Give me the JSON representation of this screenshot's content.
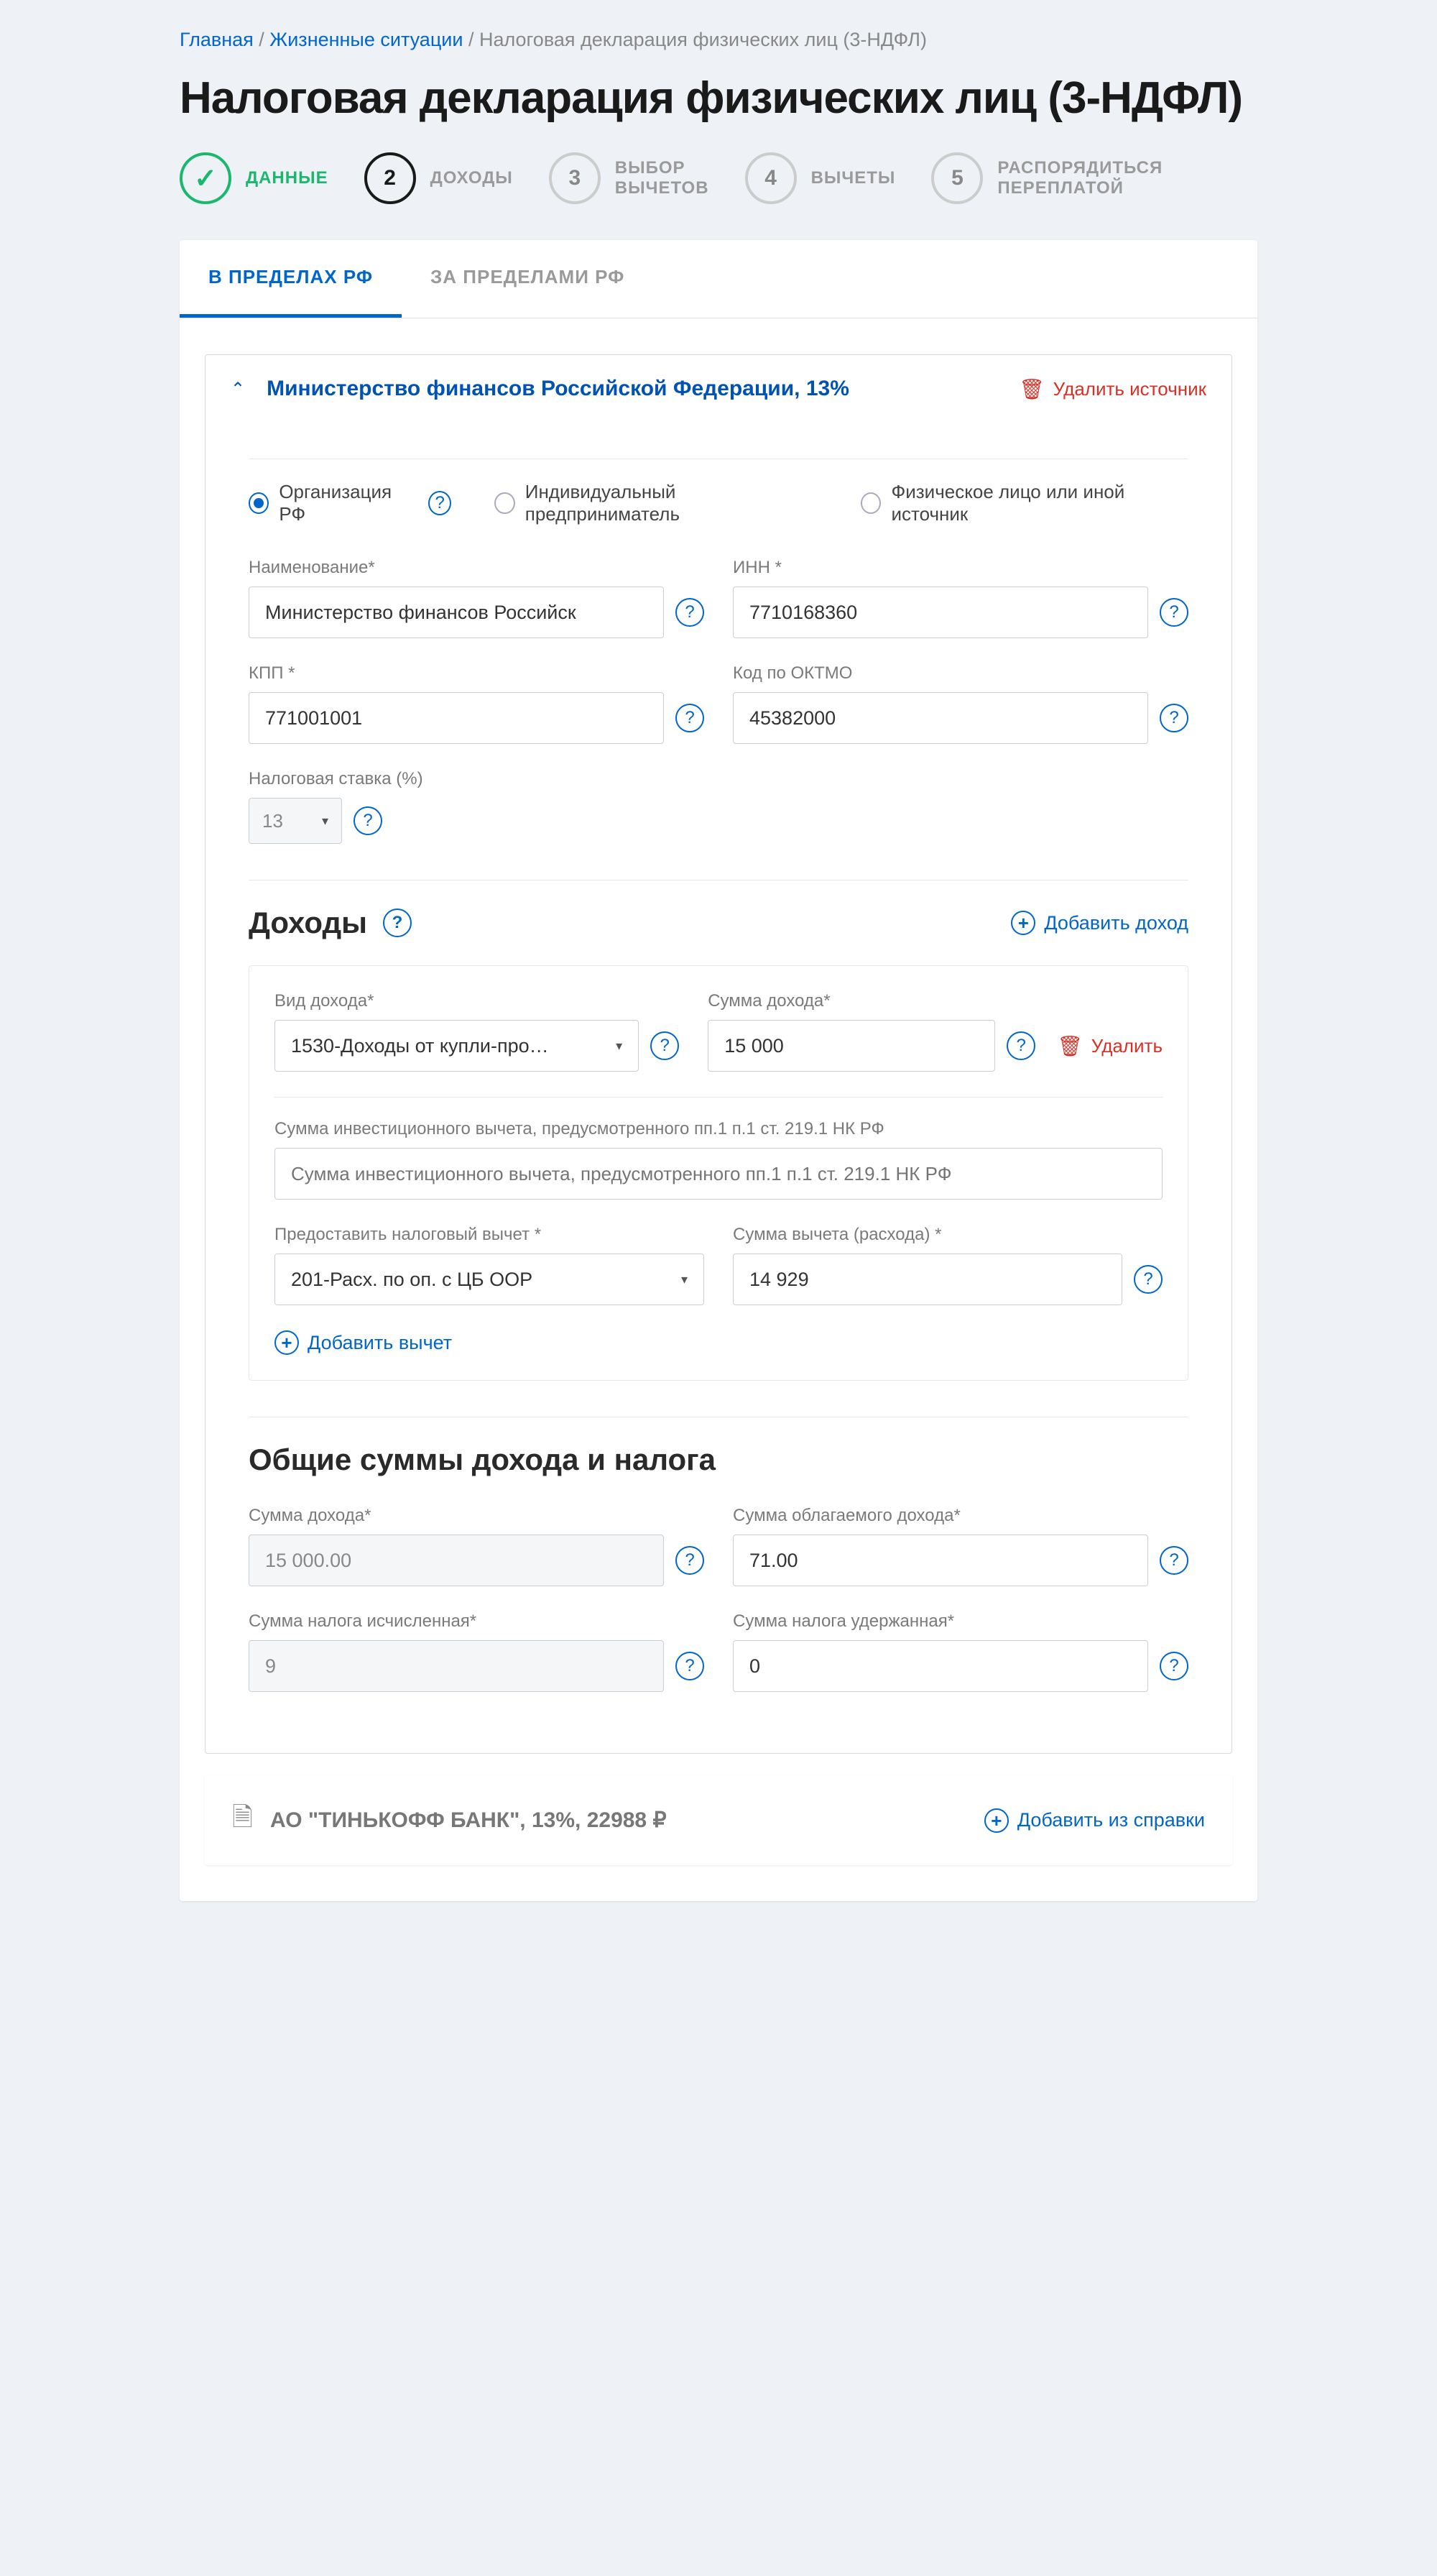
{
  "breadcrumb": {
    "home": "Главная",
    "situations": "Жизненные ситуации",
    "current": "Налоговая декларация физических лиц (3-НДФЛ)"
  },
  "page_title": "Налоговая декларация физических лиц (3-НДФЛ)",
  "steps": [
    {
      "num": "✓",
      "label": "ДАННЫЕ"
    },
    {
      "num": "2",
      "label": "ДОХОДЫ"
    },
    {
      "num": "3",
      "label": "ВЫБОР\nВЫЧЕТОВ"
    },
    {
      "num": "4",
      "label": "ВЫЧЕТЫ"
    },
    {
      "num": "5",
      "label": "РАСПОРЯДИТЬСЯ\nПЕРЕПЛАТОЙ"
    }
  ],
  "tabs": {
    "inside": "В ПРЕДЕЛАХ РФ",
    "outside": "ЗА ПРЕДЕЛАМИ РФ"
  },
  "source": {
    "title": "Министерство финансов Российской Федерации, 13%",
    "delete": "Удалить источник",
    "radios": {
      "org": "Организация РФ",
      "ip": "Индивидуальный предприниматель",
      "fl": "Физическое лицо или иной источник"
    },
    "fields": {
      "name_label": "Наименование*",
      "name_value": "Министерство финансов Российск",
      "inn_label": "ИНН *",
      "inn_value": "7710168360",
      "kpp_label": "КПП *",
      "kpp_value": "771001001",
      "oktmo_label": "Код по ОКТМО",
      "oktmo_value": "45382000",
      "rate_label": "Налоговая ставка (%)",
      "rate_value": "13"
    }
  },
  "incomes": {
    "heading": "Доходы",
    "add": "Добавить доход",
    "type_label": "Вид дохода*",
    "type_value": "1530-Доходы от купли-про…",
    "sum_label": "Сумма дохода*",
    "sum_value": "15 000",
    "delete": "Удалить",
    "inv_label": "Сумма инвестиционного вычета, предусмотренного пп.1 п.1 ст. 219.1 НК РФ",
    "inv_placeholder": "Сумма инвестиционного вычета, предусмотренного пп.1 п.1 ст. 219.1 НК РФ",
    "deduct_label": "Предоставить налоговый вычет *",
    "deduct_value": "201-Расх. по оп. с ЦБ ООР",
    "deduct_sum_label": "Сумма вычета (расхода) *",
    "deduct_sum_value": "14 929",
    "add_deduction": "Добавить вычет"
  },
  "totals": {
    "heading": "Общие суммы дохода и налога",
    "sum_income_label": "Сумма дохода*",
    "sum_income_value": "15 000.00",
    "sum_taxable_label": "Сумма облагаемого дохода*",
    "sum_taxable_value": "71.00",
    "sum_calc_label": "Сумма налога исчисленная*",
    "sum_calc_value": "9",
    "sum_held_label": "Сумма налога удержанная*",
    "sum_held_value": "0"
  },
  "collapsed": {
    "title": "АО \"ТИНЬКОФФ БАНК\", 13%, 22988 ₽",
    "add": "Добавить из справки"
  }
}
